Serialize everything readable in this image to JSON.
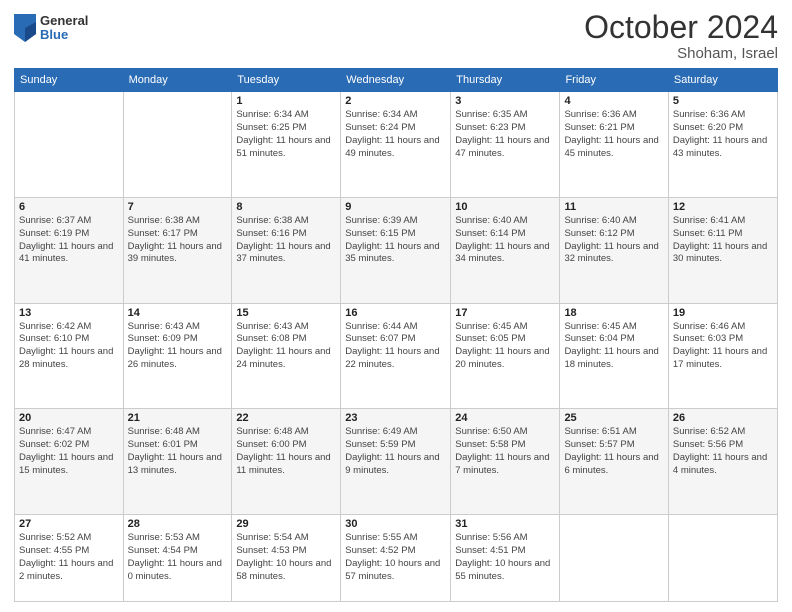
{
  "header": {
    "logo_general": "General",
    "logo_blue": "Blue",
    "title": "October 2024",
    "location": "Shoham, Israel"
  },
  "days_of_week": [
    "Sunday",
    "Monday",
    "Tuesday",
    "Wednesday",
    "Thursday",
    "Friday",
    "Saturday"
  ],
  "weeks": [
    [
      {
        "num": "",
        "detail": ""
      },
      {
        "num": "",
        "detail": ""
      },
      {
        "num": "1",
        "detail": "Sunrise: 6:34 AM\nSunset: 6:25 PM\nDaylight: 11 hours and 51 minutes."
      },
      {
        "num": "2",
        "detail": "Sunrise: 6:34 AM\nSunset: 6:24 PM\nDaylight: 11 hours and 49 minutes."
      },
      {
        "num": "3",
        "detail": "Sunrise: 6:35 AM\nSunset: 6:23 PM\nDaylight: 11 hours and 47 minutes."
      },
      {
        "num": "4",
        "detail": "Sunrise: 6:36 AM\nSunset: 6:21 PM\nDaylight: 11 hours and 45 minutes."
      },
      {
        "num": "5",
        "detail": "Sunrise: 6:36 AM\nSunset: 6:20 PM\nDaylight: 11 hours and 43 minutes."
      }
    ],
    [
      {
        "num": "6",
        "detail": "Sunrise: 6:37 AM\nSunset: 6:19 PM\nDaylight: 11 hours and 41 minutes."
      },
      {
        "num": "7",
        "detail": "Sunrise: 6:38 AM\nSunset: 6:17 PM\nDaylight: 11 hours and 39 minutes."
      },
      {
        "num": "8",
        "detail": "Sunrise: 6:38 AM\nSunset: 6:16 PM\nDaylight: 11 hours and 37 minutes."
      },
      {
        "num": "9",
        "detail": "Sunrise: 6:39 AM\nSunset: 6:15 PM\nDaylight: 11 hours and 35 minutes."
      },
      {
        "num": "10",
        "detail": "Sunrise: 6:40 AM\nSunset: 6:14 PM\nDaylight: 11 hours and 34 minutes."
      },
      {
        "num": "11",
        "detail": "Sunrise: 6:40 AM\nSunset: 6:12 PM\nDaylight: 11 hours and 32 minutes."
      },
      {
        "num": "12",
        "detail": "Sunrise: 6:41 AM\nSunset: 6:11 PM\nDaylight: 11 hours and 30 minutes."
      }
    ],
    [
      {
        "num": "13",
        "detail": "Sunrise: 6:42 AM\nSunset: 6:10 PM\nDaylight: 11 hours and 28 minutes."
      },
      {
        "num": "14",
        "detail": "Sunrise: 6:43 AM\nSunset: 6:09 PM\nDaylight: 11 hours and 26 minutes."
      },
      {
        "num": "15",
        "detail": "Sunrise: 6:43 AM\nSunset: 6:08 PM\nDaylight: 11 hours and 24 minutes."
      },
      {
        "num": "16",
        "detail": "Sunrise: 6:44 AM\nSunset: 6:07 PM\nDaylight: 11 hours and 22 minutes."
      },
      {
        "num": "17",
        "detail": "Sunrise: 6:45 AM\nSunset: 6:05 PM\nDaylight: 11 hours and 20 minutes."
      },
      {
        "num": "18",
        "detail": "Sunrise: 6:45 AM\nSunset: 6:04 PM\nDaylight: 11 hours and 18 minutes."
      },
      {
        "num": "19",
        "detail": "Sunrise: 6:46 AM\nSunset: 6:03 PM\nDaylight: 11 hours and 17 minutes."
      }
    ],
    [
      {
        "num": "20",
        "detail": "Sunrise: 6:47 AM\nSunset: 6:02 PM\nDaylight: 11 hours and 15 minutes."
      },
      {
        "num": "21",
        "detail": "Sunrise: 6:48 AM\nSunset: 6:01 PM\nDaylight: 11 hours and 13 minutes."
      },
      {
        "num": "22",
        "detail": "Sunrise: 6:48 AM\nSunset: 6:00 PM\nDaylight: 11 hours and 11 minutes."
      },
      {
        "num": "23",
        "detail": "Sunrise: 6:49 AM\nSunset: 5:59 PM\nDaylight: 11 hours and 9 minutes."
      },
      {
        "num": "24",
        "detail": "Sunrise: 6:50 AM\nSunset: 5:58 PM\nDaylight: 11 hours and 7 minutes."
      },
      {
        "num": "25",
        "detail": "Sunrise: 6:51 AM\nSunset: 5:57 PM\nDaylight: 11 hours and 6 minutes."
      },
      {
        "num": "26",
        "detail": "Sunrise: 6:52 AM\nSunset: 5:56 PM\nDaylight: 11 hours and 4 minutes."
      }
    ],
    [
      {
        "num": "27",
        "detail": "Sunrise: 5:52 AM\nSunset: 4:55 PM\nDaylight: 11 hours and 2 minutes."
      },
      {
        "num": "28",
        "detail": "Sunrise: 5:53 AM\nSunset: 4:54 PM\nDaylight: 11 hours and 0 minutes."
      },
      {
        "num": "29",
        "detail": "Sunrise: 5:54 AM\nSunset: 4:53 PM\nDaylight: 10 hours and 58 minutes."
      },
      {
        "num": "30",
        "detail": "Sunrise: 5:55 AM\nSunset: 4:52 PM\nDaylight: 10 hours and 57 minutes."
      },
      {
        "num": "31",
        "detail": "Sunrise: 5:56 AM\nSunset: 4:51 PM\nDaylight: 10 hours and 55 minutes."
      },
      {
        "num": "",
        "detail": ""
      },
      {
        "num": "",
        "detail": ""
      }
    ]
  ]
}
